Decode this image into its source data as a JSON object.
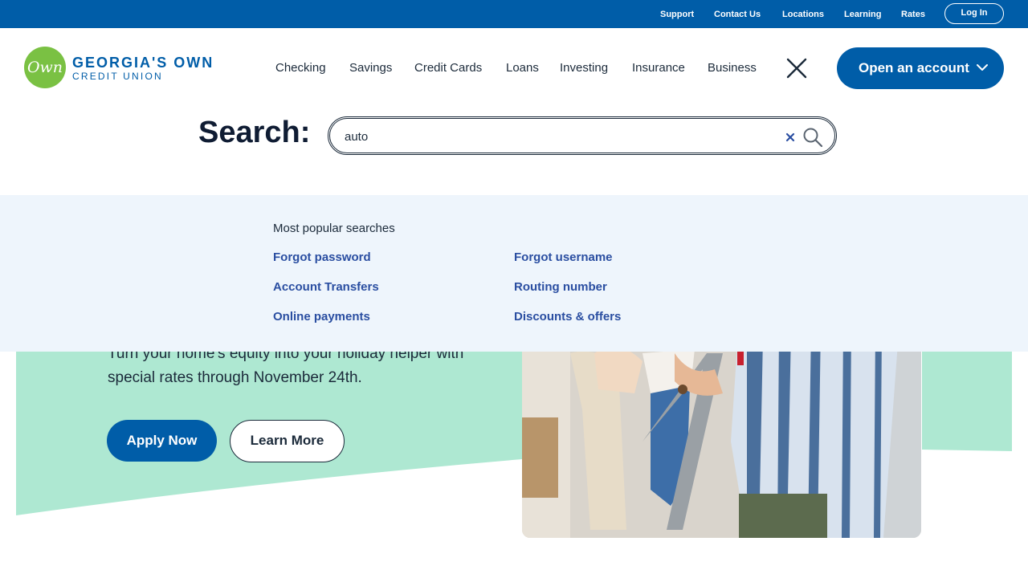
{
  "utility_bar": {
    "links": [
      "Support",
      "Contact Us",
      "Locations",
      "Learning",
      "Rates"
    ],
    "login_label": "Log In"
  },
  "logo": {
    "mark_text": "Own",
    "line1": "GEORGIA'S OWN",
    "line2": "CREDIT UNION"
  },
  "nav": {
    "items": [
      "Checking",
      "Savings",
      "Credit Cards",
      "Loans",
      "Investing",
      "Insurance",
      "Business"
    ],
    "open_account_label": "Open an account"
  },
  "search": {
    "label": "Search:",
    "value": "auto"
  },
  "popular": {
    "heading": "Most popular searches",
    "left": [
      "Forgot password",
      "Account Transfers",
      "Online payments"
    ],
    "right": [
      "Forgot username",
      "Routing number",
      "Discounts & offers"
    ]
  },
  "hero": {
    "text_visible": "Turn your home's equity into your holiday helper with special rates through November 24th.",
    "apply_label": "Apply Now",
    "learn_label": "Learn More"
  },
  "colors": {
    "brand_blue": "#005da8",
    "logo_green": "#7ac143",
    "link_blue": "#2a4ea1",
    "dropdown_bg": "#eef5fc",
    "hero_mint": "#aee8d2"
  }
}
